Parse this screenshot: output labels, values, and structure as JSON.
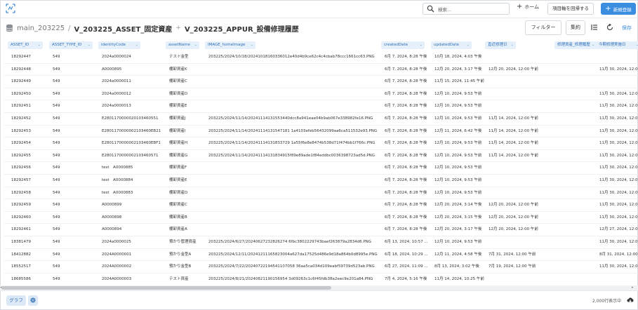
{
  "topbar": {
    "search_placeholder": "検索...",
    "home_label": "ホーム",
    "return_label": "項目軸を回帰する",
    "new_label": "新規登録"
  },
  "title": {
    "db": "main_203225",
    "sep": "/",
    "main": "V_203225_ASSET_固定資産",
    "plus": "+",
    "sub": "V_203225_APPUR_設備修理履歴"
  },
  "toolbar": {
    "filter_label": "フィルター",
    "summary_label": "集約",
    "save_label": "保存"
  },
  "columns": [
    "ASSET_ID",
    "ASSET_TYPE_ID",
    "identityCode",
    "assetName",
    "IMAGE_homeImage",
    "createdDate",
    "updatedDate",
    "直近修理日",
    "修理資産_修理履歴",
    "今期修理実施日"
  ],
  "rows": [
    [
      "18292447",
      "549",
      "2024a0000024",
      "テスト金型",
      "203225/2024/10/18/20241018160336012e40d4b9ce62c4c4cbab78ccc1661cc63.PNG",
      "6月 7, 2024, 8:28 午後",
      "10月 18, 2024, 4:03 午後",
      "",
      "",
      ""
    ],
    [
      "18292448",
      "549",
      "A0000895",
      "棚卸資産K",
      "",
      "6月 7, 2024, 8:28 午後",
      "12月 20, 2024, 3:17 午後",
      "12月 20, 2024, 12:00 午前",
      "",
      "11月 30, 2024, 12:00 午"
    ],
    [
      "18292449",
      "549",
      "2024a0000011",
      "棚卸資産C",
      "",
      "6月 7, 2024, 8:28 午後",
      "11月 15, 2024, 11:45 午前",
      "",
      "",
      ""
    ],
    [
      "18292450",
      "549",
      "2024a0000012",
      "棚卸資産D",
      "",
      "6月 7, 2024, 8:28 午後",
      "12月 10, 2024, 9:53 午前",
      "",
      "",
      "11月 30, 2024, 12:00 午"
    ],
    [
      "18292451",
      "549",
      "2024a0000013",
      "棚卸資産E",
      "",
      "6月 7, 2024, 8:28 午後",
      "12月 10, 2024, 9:53 午前",
      "",
      "",
      "11月 30, 2024, 12:00 午"
    ],
    [
      "18292452",
      "549",
      "E2801170000020103460551",
      "棚卸資産J",
      "203225/2024/11/14/20241114131553440dcc8a941eae04b9ab067e338982fe16.PNG",
      "6月 7, 2024, 8:28 午後",
      "12月 10, 2024, 9:53 午前",
      "11月 14, 2024, 12:00 午前",
      "",
      "11月 30, 2024, 12:00 午"
    ],
    [
      "18292453",
      "549",
      "E2801170000002103460EB21",
      "棚卸資産I",
      "203225/2024/11/14/20241114131547181 1a4103efeb56432099aa6ca511532e93.PNG",
      "6月 7, 2024, 8:28 午後",
      "12月 11, 2024, 6:42 午後",
      "11月 14, 2024, 12:00 午前",
      "",
      "11月 30, 2024, 12:00 午"
    ],
    [
      "18292454",
      "549",
      "E2801170000002103460EBF1",
      "棚卸資産H",
      "203225/2024/11/14/20241114131833729 1a55f6e8e8474b538d71f474bb1f766c.PNG",
      "6月 7, 2024, 8:28 午後",
      "12月 10, 2024, 9:53 午前",
      "11月 14, 2024, 12:00 午前",
      "",
      "11月 30, 2024, 12:00 午"
    ],
    [
      "18292455",
      "549",
      "E2801170000002103460571",
      "棚卸資産G",
      "203225/2024/11/14/20241114131834915f89e89ade1f84eddbc0036398723ad5d.PNG",
      "6月 7, 2024, 8:28 午後",
      "12月 10, 2024, 9:53 午前",
      "11月 14, 2024, 12:00 午前",
      "",
      "11月 30, 2024, 12:00 午"
    ],
    [
      "18292456",
      "549",
      "test　A0000885",
      "棚卸資産F",
      "",
      "6月 7, 2024, 8:28 午後",
      "12月 10, 2024, 9:53 午前",
      "",
      "",
      "11月 30, 2024, 12:00 午"
    ],
    [
      "18292457",
      "549",
      "test　A0000884",
      "棚卸資産E",
      "",
      "6月 7, 2024, 8:28 午後",
      "12月 10, 2024, 9:53 午前",
      "",
      "",
      "11月 30, 2024, 12:00 午"
    ],
    [
      "18292458",
      "549",
      "test　A0000883",
      "棚卸資産D",
      "",
      "6月 7, 2024, 8:28 午後",
      "12月 10, 2024, 9:53 午前",
      "",
      "",
      "11月 30, 2024, 12:00 午"
    ],
    [
      "18292459",
      "549",
      "A0000899",
      "棚卸資産C",
      "",
      "6月 7, 2024, 8:28 午後",
      "12月 20, 2024, 3:14 午後",
      "12月 20, 2024, 12:00 午前",
      "",
      "11月 30, 2024, 12:00 午"
    ],
    [
      "18292460",
      "549",
      "A0000898",
      "棚卸資産B",
      "",
      "6月 7, 2024, 8:28 午後",
      "12月 20, 2024, 3:15 午後",
      "12月 20, 2024, 12:00 午前",
      "",
      "11月 30, 2024, 12:00 午"
    ],
    [
      "18292461",
      "549",
      "A0000894",
      "棚卸資産A",
      "",
      "6月 7, 2024, 8:28 午後",
      "12月 20, 2024, 3:17 午後",
      "12月 20, 2024, 12:00 午前",
      "",
      "12月 27, 2024, 12:00 午"
    ],
    [
      "18381479",
      "549",
      "2024a0000025",
      "預かり管理資産",
      "203225/2024/6/27/20240627232826274 6fbc3802229743baef263879a2834d6.PNG",
      "6月 13, 2024, 10:57 ...",
      "12月 10, 2024, 9:53 午前",
      "",
      "",
      "11月 30, 2024, 12:00 午"
    ],
    [
      "18412882",
      "549",
      "2024A0000001",
      "預かり金型A",
      "203225/2024/12/11/20241211165823004a627da17525d486e9d18a864b0d8995e.PNG",
      "6月 18, 2024, 10:29 ...",
      "12月 11, 2024, 4:58 午後",
      "7月 31, 2024, 12:00 午前",
      "",
      "8月 31, 2024, 12:00 午"
    ],
    [
      "18552517",
      "549",
      "2024A0000002",
      "預かり金型B",
      "203225/2024/7/22/20240722194541107058 36aa5ca034d109eabf59739d523ab.PNG",
      "6月 27, 2024, 11:09 ...",
      "8月 13, 2024, 3:02 午後",
      "7月 19, 2024, 12:00 午前",
      "",
      "11月 30, 2024, 12:00 午"
    ],
    [
      "18685586",
      "549",
      "2024A0000003",
      "テスト資産",
      "203225/2024/8/21/20240821190156954 3d09263c1c6f45fdb38a2eec9e201a84.PNG",
      "7月 4, 2024, 5:16 午後",
      "11月 14, 2024, 10:25 午前",
      "",
      "",
      ""
    ]
  ],
  "footer": {
    "graph_label": "グラフ",
    "count_label": "2,000行表示中"
  }
}
